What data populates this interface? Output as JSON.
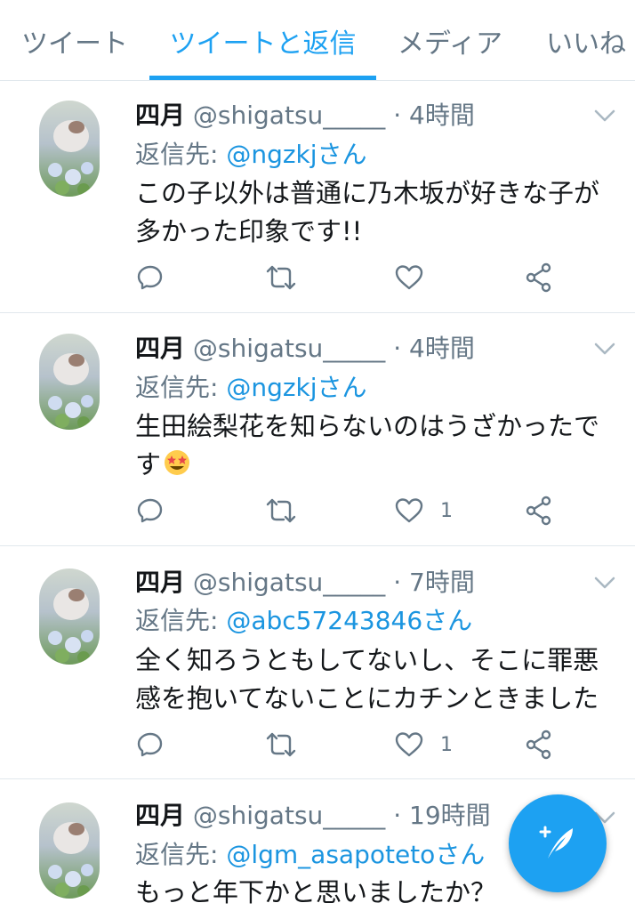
{
  "tabs": [
    {
      "label": "ツイート",
      "active": false
    },
    {
      "label": "ツイートと返信",
      "active": true
    },
    {
      "label": "メディア",
      "active": false
    },
    {
      "label": "いいね",
      "active": false
    }
  ],
  "tweets": [
    {
      "name": "四月",
      "handle": "@shigatsu_____",
      "separator": "·",
      "time": "4時間",
      "reply_label": "返信先:",
      "reply_to": "@ngzkjさん",
      "text": "この子以外は普通に乃木坂が好きな子が多かった印象です!!",
      "like_count": ""
    },
    {
      "name": "四月",
      "handle": "@shigatsu_____",
      "separator": "·",
      "time": "4時間",
      "reply_label": "返信先:",
      "reply_to": "@ngzkjさん",
      "text": "生田絵梨花を知らないのはうざかったです",
      "emoji": "star-struck-emoji",
      "like_count": "1"
    },
    {
      "name": "四月",
      "handle": "@shigatsu_____",
      "separator": "·",
      "time": "7時間",
      "reply_label": "返信先:",
      "reply_to": "@abc57243846さん",
      "text": "全く知ろうともしてないし、そこに罪悪感を抱いてないことにカチンときました",
      "like_count": "1"
    },
    {
      "name": "四月",
      "handle": "@shigatsu_____",
      "separator": "·",
      "time": "19時間",
      "reply_label": "返信先:",
      "reply_to": "@lgm_asapotetoさん",
      "text": "もっと年下かと思いましたか？",
      "like_count": ""
    }
  ],
  "icons": {
    "reply": "reply-icon",
    "retweet": "retweet-icon",
    "like": "heart-icon",
    "share": "share-icon",
    "caret": "chevron-down-icon",
    "compose": "compose-tweet-icon"
  },
  "colors": {
    "accent": "#1da1f2",
    "link": "#1b95e0",
    "muted": "#657786",
    "text": "#14171a"
  }
}
